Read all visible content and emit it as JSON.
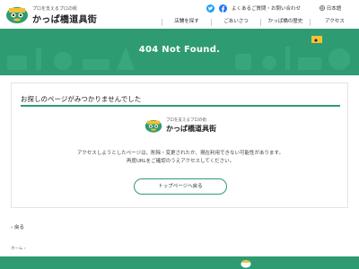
{
  "header": {
    "logo_tagline": "プロを支えるプロの街",
    "logo_name": "かっぱ橋道具街",
    "utility_links": [
      "よくあるご質問・お問い合わせ"
    ],
    "language": "日本語",
    "nav": [
      "店舗を探す",
      "ごあいさつ",
      "かっぱ橋の歴史",
      "アクセス"
    ]
  },
  "hero": {
    "title": "404 Not Found."
  },
  "card": {
    "title": "お探しのページがみつかりませんでした",
    "logo_tagline": "プロを支えるプロの街",
    "logo_name": "かっぱ橋道具街",
    "message_line1": "アクセスしようとしたページは、削除・変更されたか、現在利用できない可能性があります。",
    "message_line2": "再度URLをご確認のうえアクセスしてください。",
    "button_label": "トップページへ戻る"
  },
  "back_link": "戻る",
  "breadcrumb": "ホーム",
  "colors": {
    "brand_green": "#2f9b72"
  }
}
